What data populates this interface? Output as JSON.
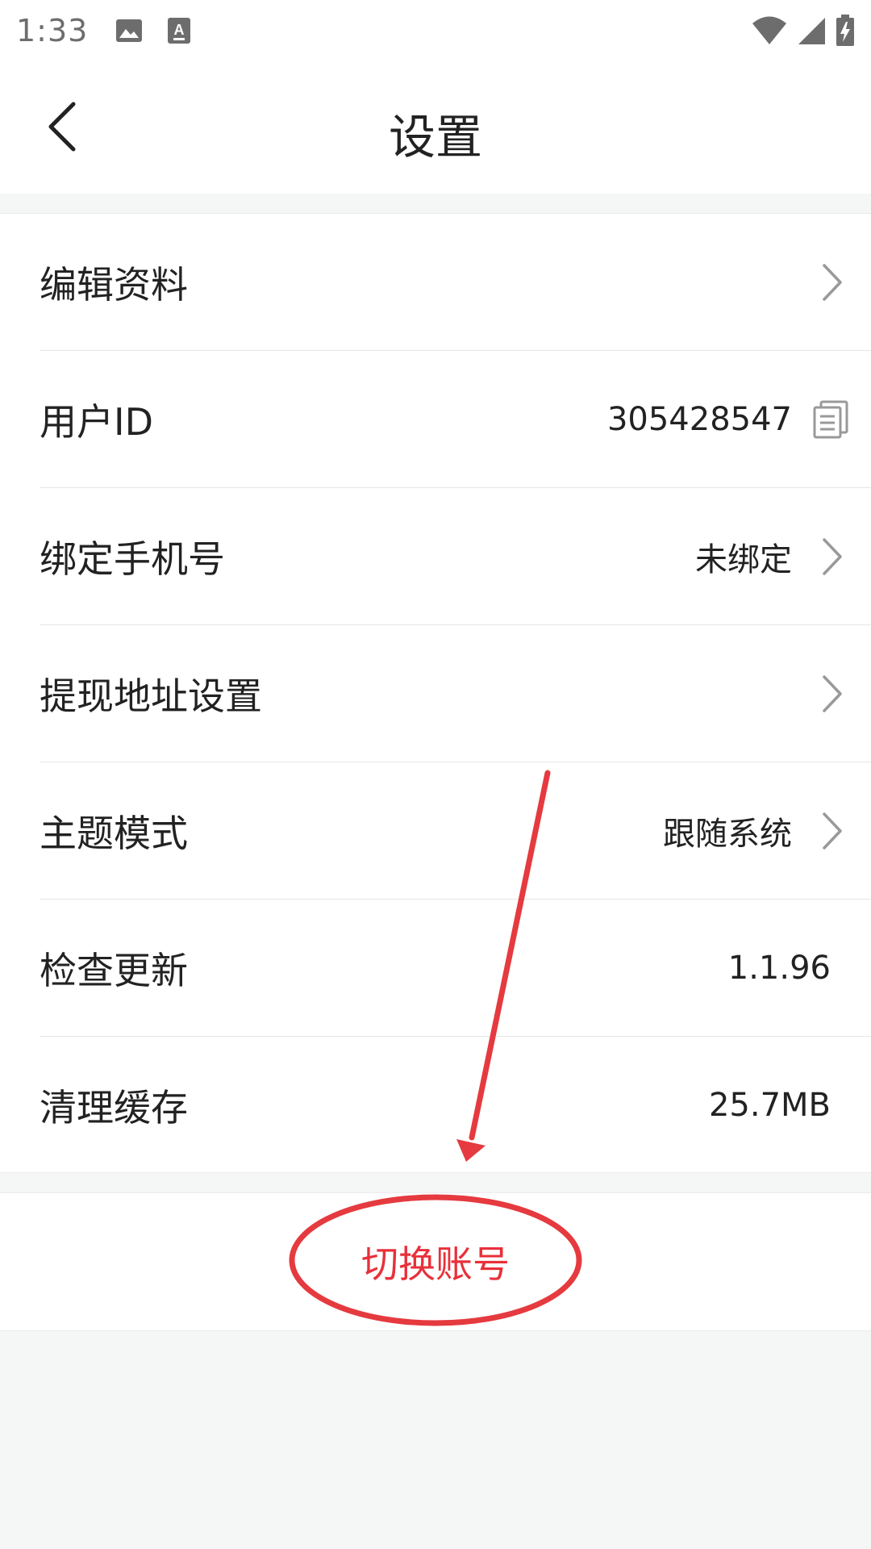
{
  "status_bar": {
    "time": "1:33",
    "left_icons": [
      "image-icon",
      "text-input-icon"
    ],
    "right_icons": [
      "wifi-icon",
      "signal-icon",
      "battery-charging-icon"
    ]
  },
  "header": {
    "title": "设置",
    "back_icon": "chevron-left-icon"
  },
  "settings": {
    "edit_profile": {
      "label": "编辑资料"
    },
    "user_id": {
      "label": "用户ID",
      "value": "305428547",
      "icon": "copy-icon"
    },
    "bind_phone": {
      "label": "绑定手机号",
      "value": "未绑定"
    },
    "withdraw_address": {
      "label": "提现地址设置"
    },
    "theme_mode": {
      "label": "主题模式",
      "value": "跟随系统"
    },
    "check_update": {
      "label": "检查更新",
      "value": "1.1.96"
    },
    "clear_cache": {
      "label": "清理缓存",
      "value": "25.7MB"
    }
  },
  "switch_account": {
    "label": "切换账号"
  },
  "colors": {
    "accent_red": "#e8303a",
    "annotation_red": "#e53a3f",
    "background": "#f5f6f6"
  }
}
